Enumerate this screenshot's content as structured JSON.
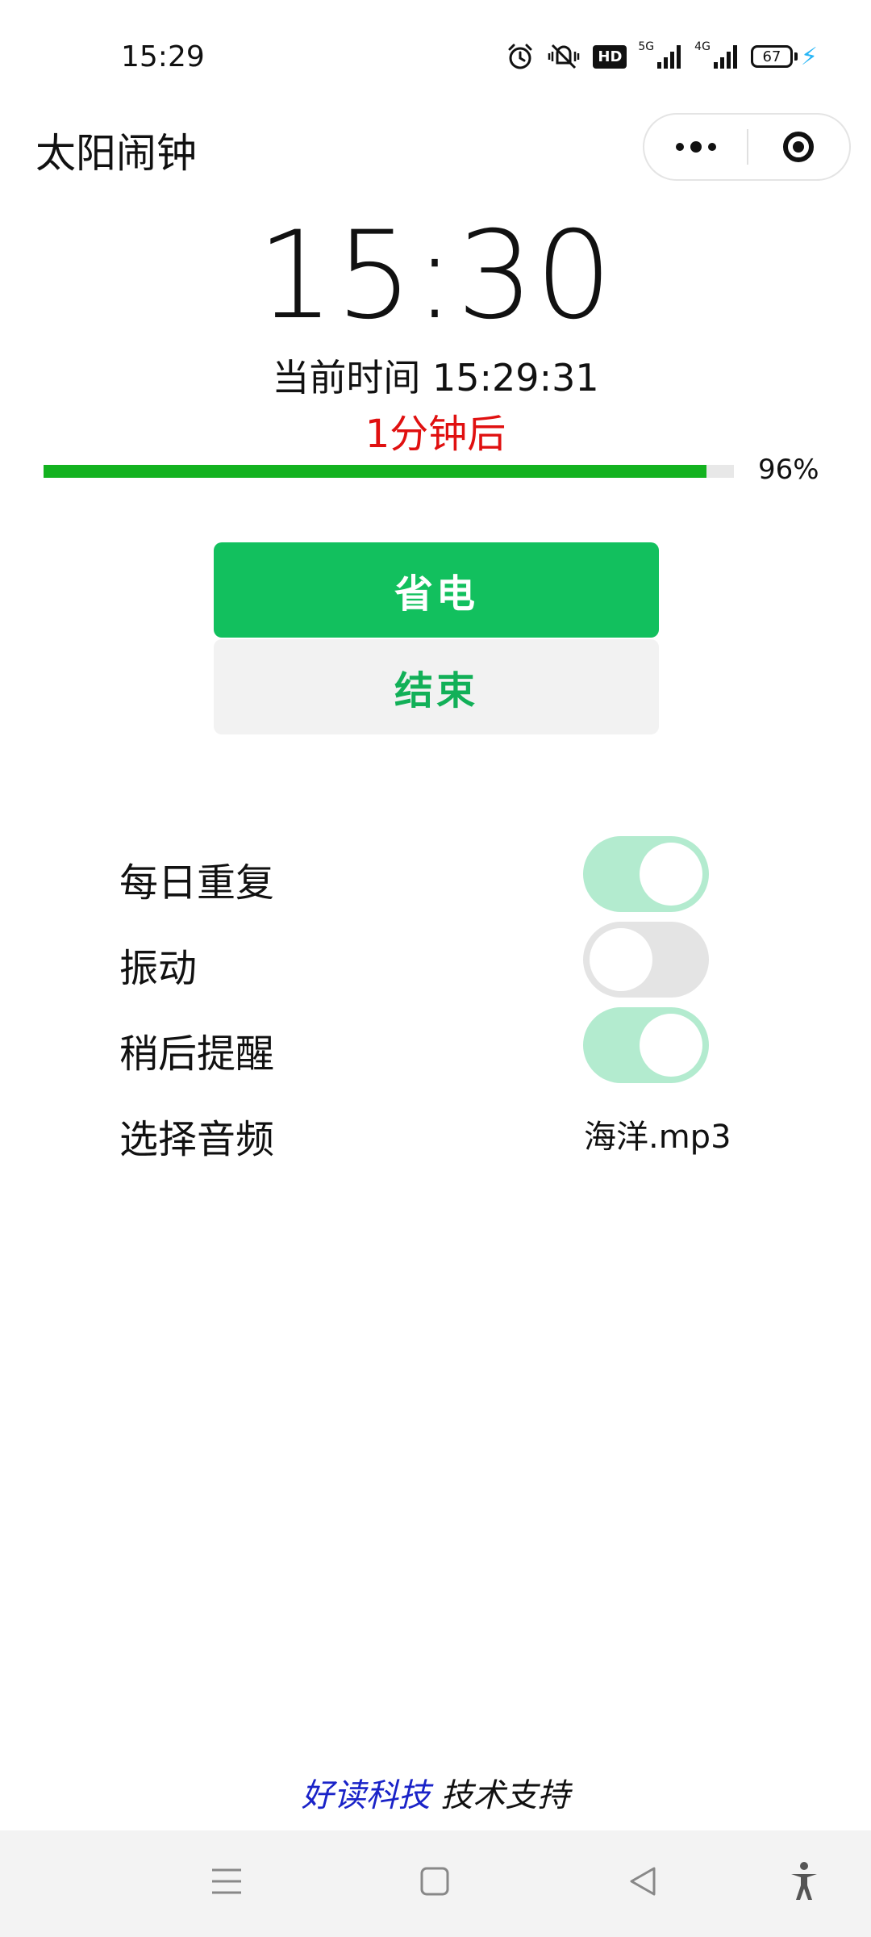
{
  "status_bar": {
    "time": "15:29",
    "hd_label": "HD",
    "signal_5g_label": "5G",
    "signal_4g_label": "4G",
    "battery_level": "67",
    "icons": [
      "alarm-icon",
      "mute-vibrate-icon",
      "hd-icon",
      "signal-5g-icon",
      "signal-4g-icon",
      "battery-icon",
      "charging-icon"
    ]
  },
  "header": {
    "title": "太阳闹钟",
    "icons": [
      "more-dots-icon",
      "target-icon"
    ]
  },
  "alarm": {
    "time": "15:30",
    "current_time_text": "当前时间 15:29:31",
    "countdown_text": "1分钟后",
    "progress_percent": 96,
    "progress_label": "96%",
    "countdown_color": "#e01010",
    "progress_color": "#13b21f"
  },
  "actions": {
    "save_label": "省电",
    "end_label": "结束",
    "accent_color": "#12c05e"
  },
  "settings": {
    "daily_repeat": {
      "label": "每日重复",
      "on": true
    },
    "vibrate": {
      "label": "振动",
      "on": false
    },
    "snooze": {
      "label": "稍后提醒",
      "on": true
    },
    "audio": {
      "label": "选择音频",
      "value": "海洋.mp3"
    }
  },
  "footer": {
    "brand": "好读科技",
    "suffix": " 技术支持",
    "brand_color": "#1a23c8"
  },
  "nav": {
    "icons": [
      "menu-icon",
      "home-square-icon",
      "back-triangle-icon",
      "accessibility-icon"
    ]
  }
}
